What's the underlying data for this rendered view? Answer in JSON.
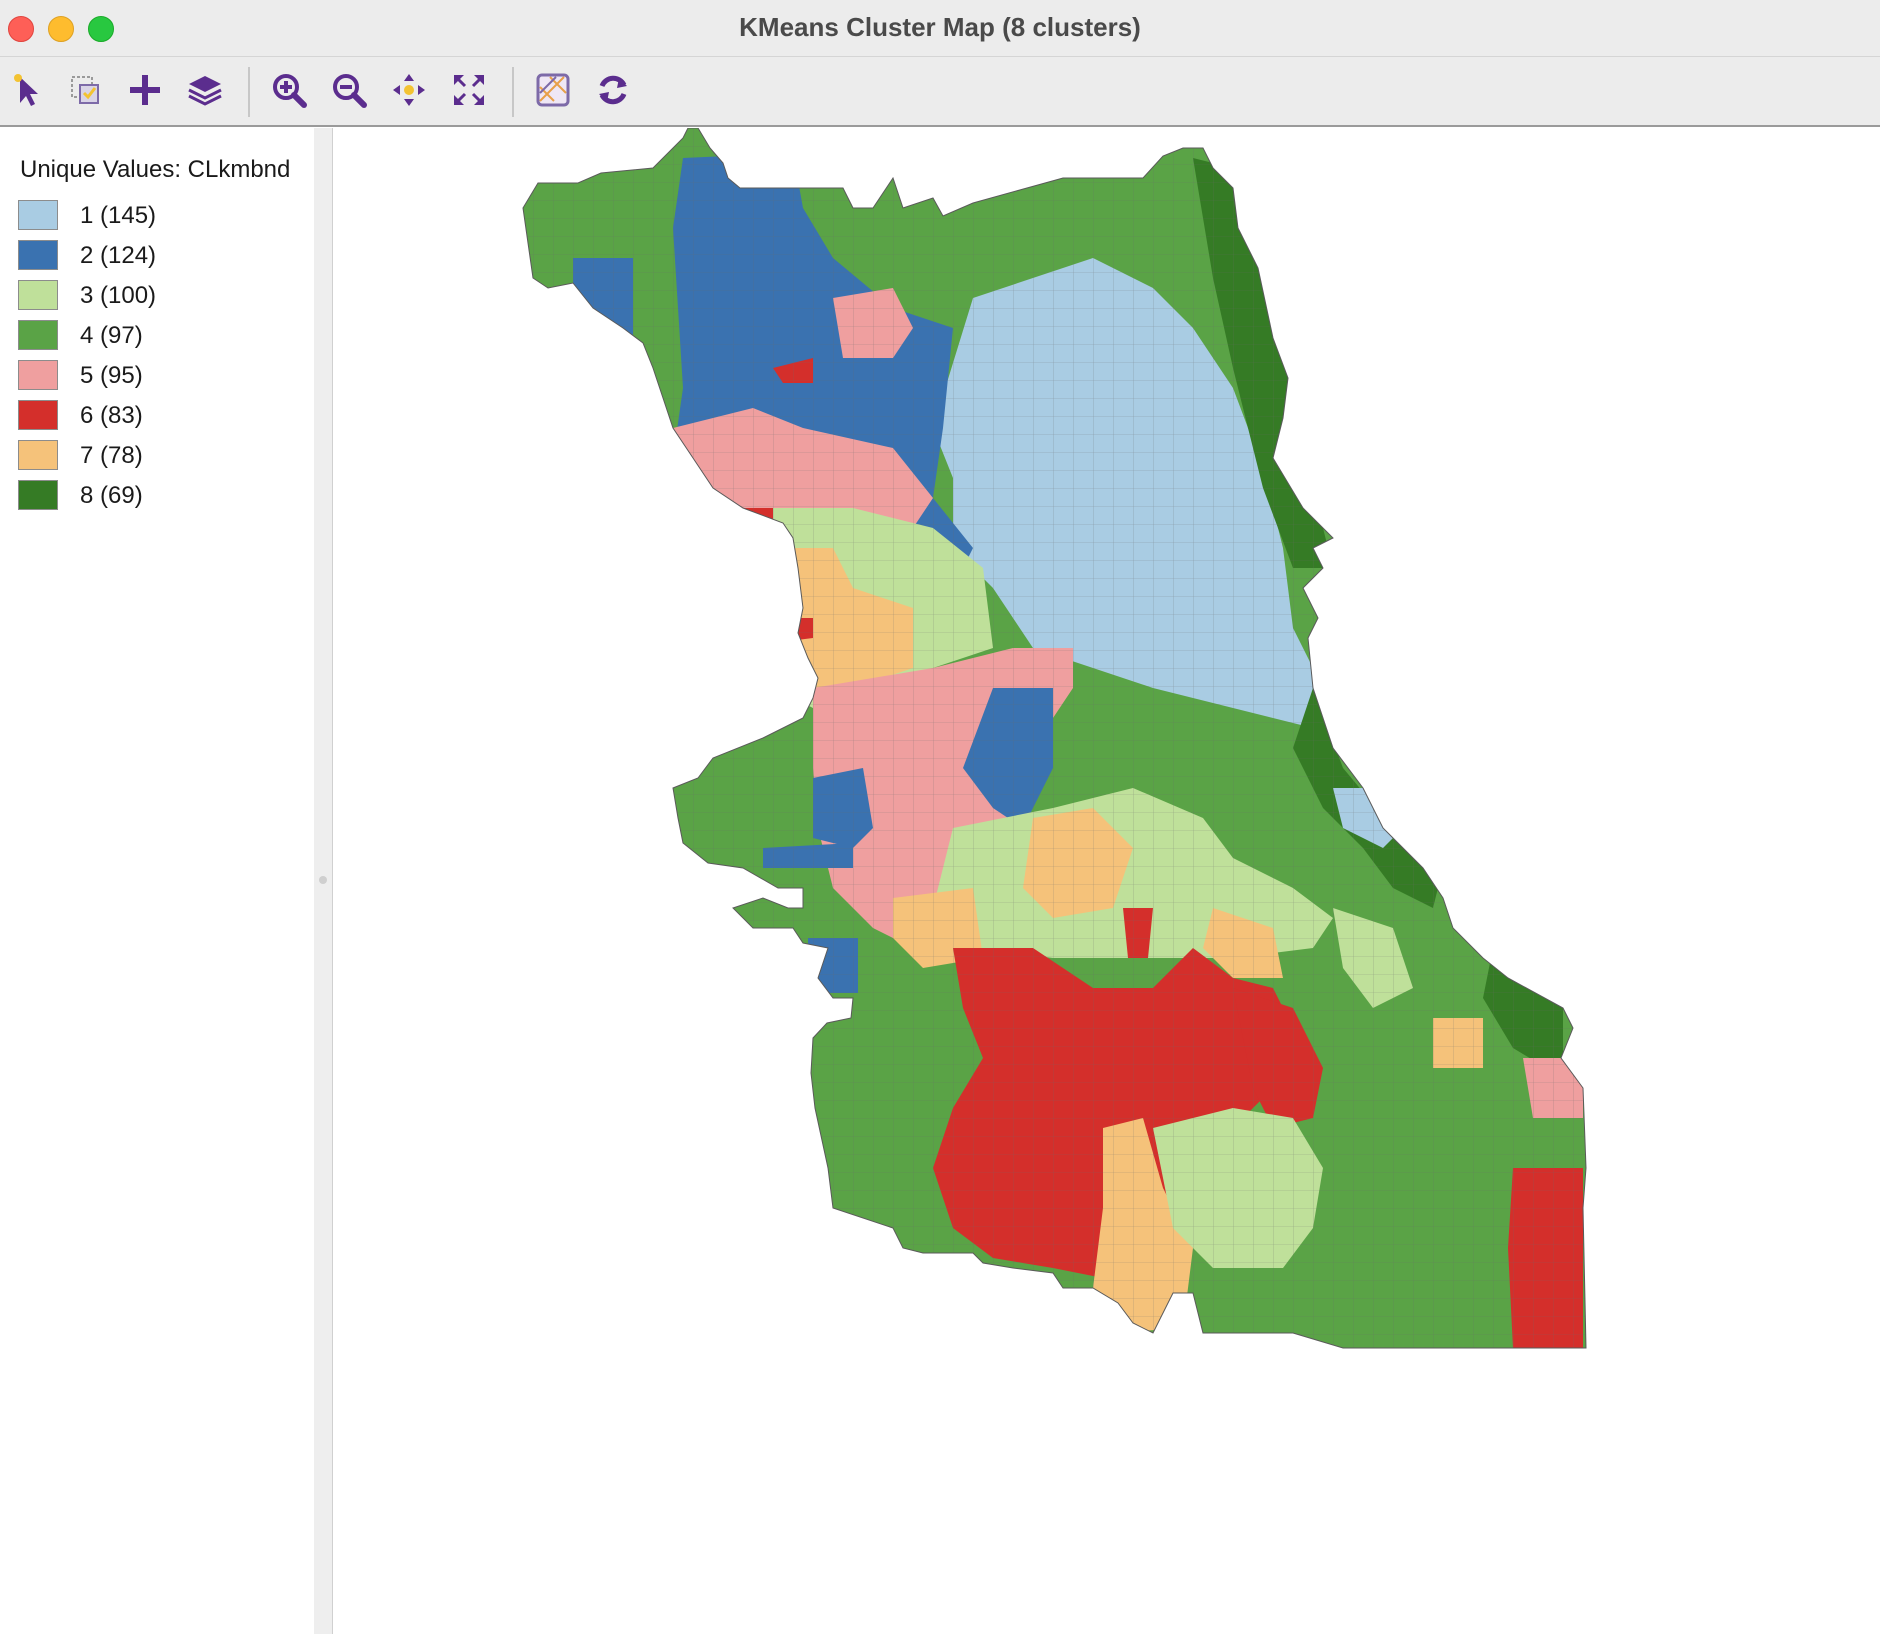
{
  "window": {
    "title": "KMeans Cluster Map (8 clusters)"
  },
  "toolbar": {
    "tools": [
      {
        "name": "select-tool-icon"
      },
      {
        "name": "selection-shape-icon"
      },
      {
        "name": "add-layer-icon"
      },
      {
        "name": "layers-icon"
      },
      {
        "name": "zoom-in-icon"
      },
      {
        "name": "zoom-out-icon"
      },
      {
        "name": "pan-icon"
      },
      {
        "name": "full-extent-icon"
      },
      {
        "name": "basemap-icon"
      },
      {
        "name": "refresh-icon"
      }
    ],
    "icon_color": "#5b2d8e"
  },
  "legend": {
    "title": "Unique Values: CLkmbnd",
    "items": [
      {
        "label": "1 (145)",
        "color": "#a9cce3"
      },
      {
        "label": "2 (124)",
        "color": "#3a72b0"
      },
      {
        "label": "3 (100)",
        "color": "#bfe09a"
      },
      {
        "label": "4 (97)",
        "color": "#5aa346"
      },
      {
        "label": "5 (95)",
        "color": "#ef9f9f"
      },
      {
        "label": "6 (83)",
        "color": "#d42f2b"
      },
      {
        "label": "7 (78)",
        "color": "#f5c27a"
      },
      {
        "label": "8 (69)",
        "color": "#357b25"
      }
    ]
  }
}
